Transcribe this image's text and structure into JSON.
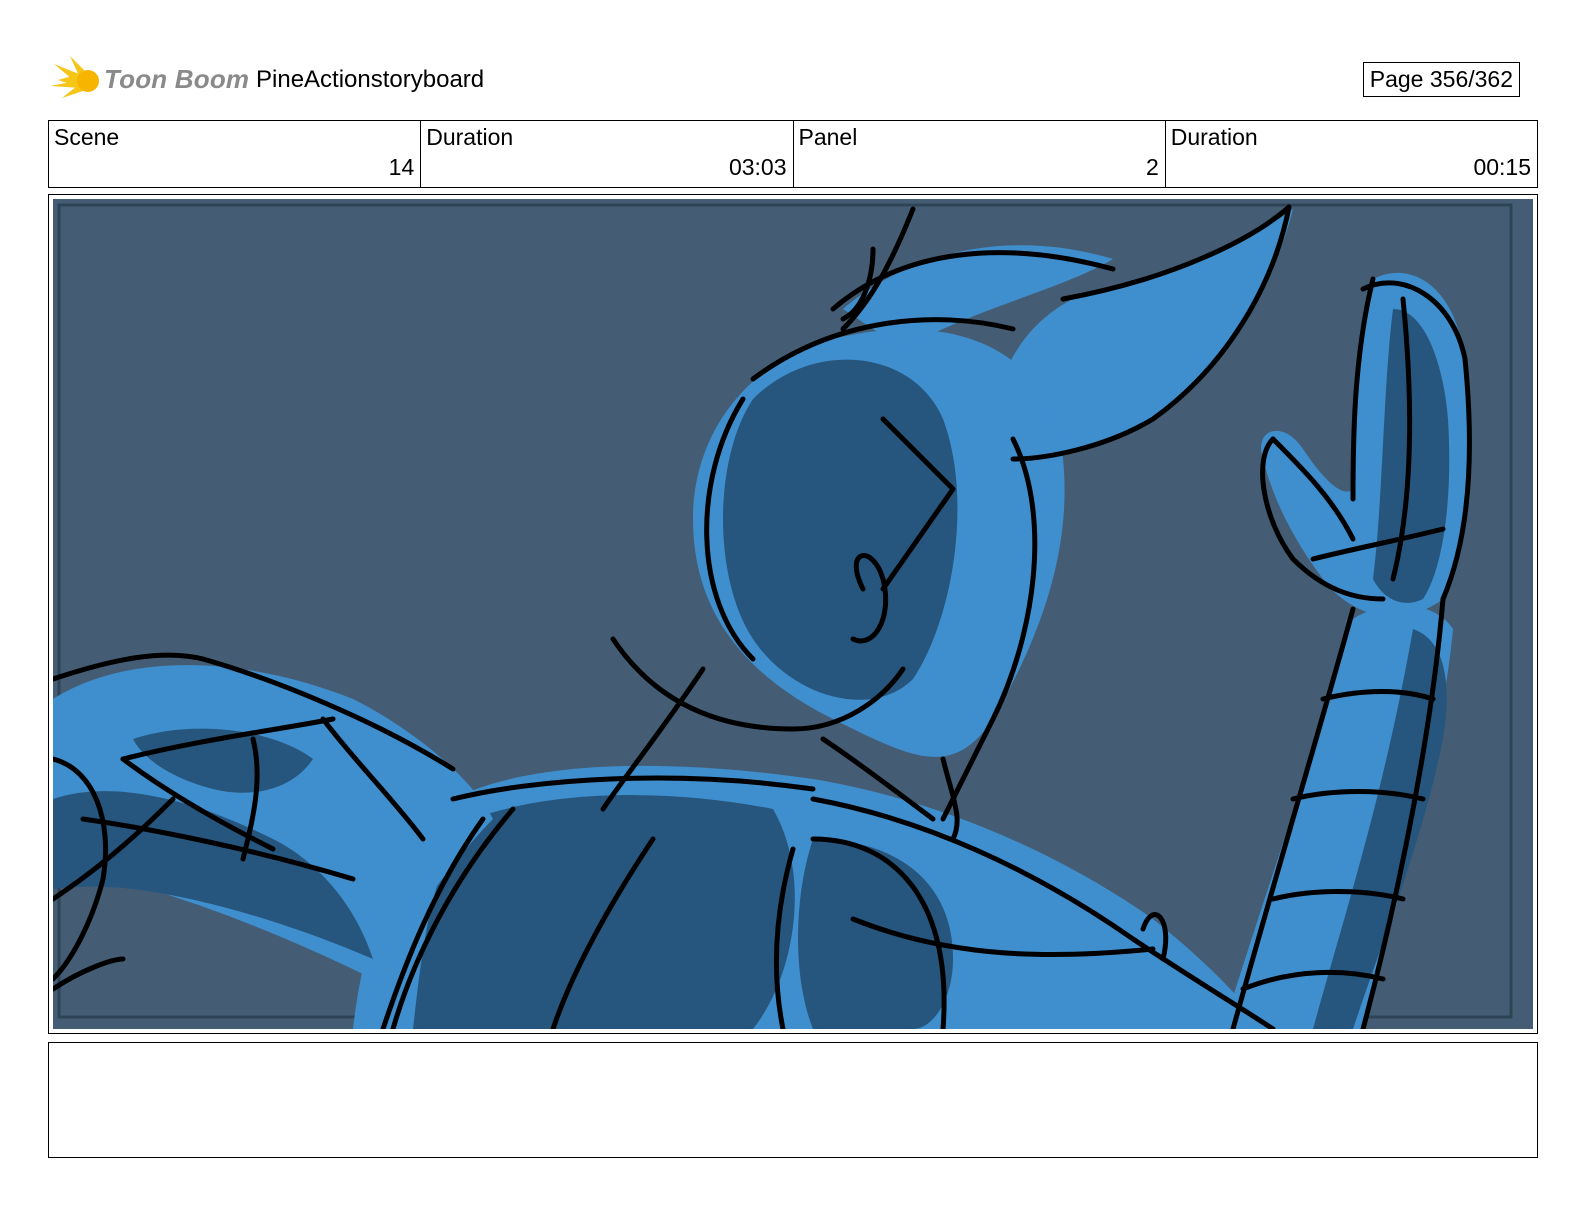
{
  "header": {
    "logo_text": "Toon Boom",
    "project_title": "PineActionstoryboard",
    "page_label": "Page 356/362"
  },
  "info": {
    "scene_label": "Scene",
    "scene_value": "14",
    "scene_duration_label": "Duration",
    "scene_duration_value": "03:03",
    "panel_label": "Panel",
    "panel_value": "2",
    "panel_duration_label": "Duration",
    "panel_duration_value": "00:15"
  },
  "panel": {
    "background_color": "#455d74",
    "fill_light": "#3f8fcf",
    "fill_dark": "#26567e",
    "line_color": "#000000"
  },
  "notes": {
    "text": ""
  },
  "colors": {
    "logo_sun": "#f5c518",
    "logo_text": "#8a8a8a",
    "border": "#000000"
  }
}
